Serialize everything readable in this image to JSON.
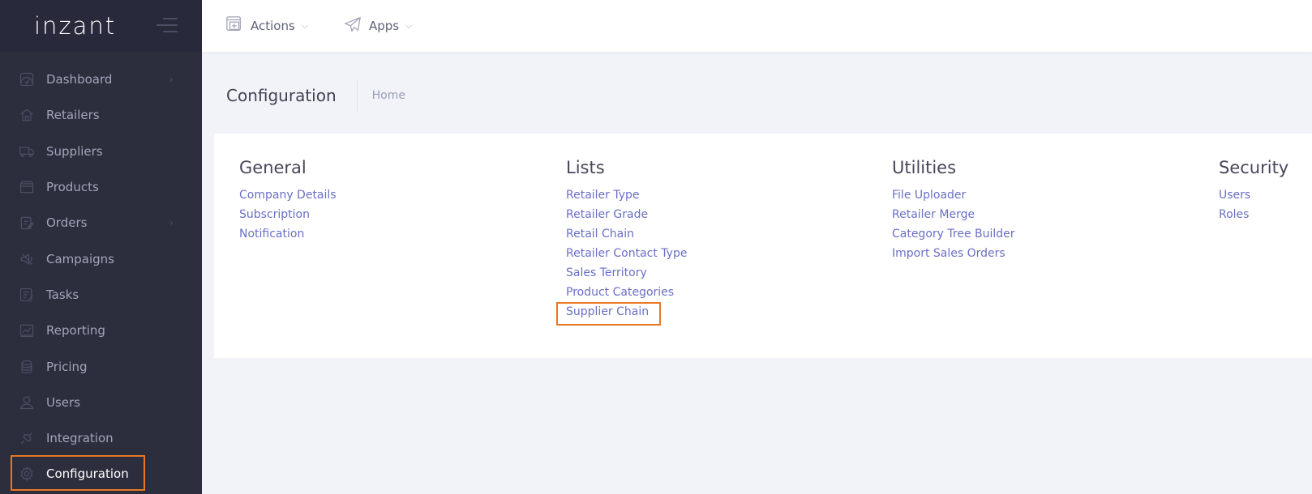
{
  "app": {
    "logo": "inzant"
  },
  "sidebar": {
    "items": [
      {
        "label": "Dashboard",
        "icon": "dashboard-icon",
        "arrow": "›"
      },
      {
        "label": "Retailers",
        "icon": "home-icon"
      },
      {
        "label": "Suppliers",
        "icon": "truck-icon"
      },
      {
        "label": "Products",
        "icon": "box-icon"
      },
      {
        "label": "Orders",
        "icon": "clipboard-icon",
        "arrow": "›"
      },
      {
        "label": "Campaigns",
        "icon": "megaphone-icon"
      },
      {
        "label": "Tasks",
        "icon": "checklist-icon"
      },
      {
        "label": "Reporting",
        "icon": "chart-icon"
      },
      {
        "label": "Pricing",
        "icon": "coins-icon"
      },
      {
        "label": "Users",
        "icon": "users-icon"
      },
      {
        "label": "Integration",
        "icon": "plug-icon"
      },
      {
        "label": "Configuration",
        "icon": "gear-icon"
      }
    ],
    "active": "Configuration"
  },
  "header": {
    "actions_label": "Actions",
    "apps_label": "Apps",
    "caret": "⌵"
  },
  "subheader": {
    "title": "Configuration",
    "breadcrumb": "Home"
  },
  "sections": {
    "general": {
      "title": "General",
      "links": [
        "Company Details",
        "Subscription",
        "Notification"
      ]
    },
    "lists": {
      "title": "Lists",
      "links": [
        "Retailer Type",
        "Retailer Grade",
        "Retail Chain",
        "Retailer Contact Type",
        "Sales Territory",
        "Product Categories",
        "Supplier Chain"
      ]
    },
    "utilities": {
      "title": "Utilities",
      "links": [
        "File Uploader",
        "Retailer Merge",
        "Category Tree Builder",
        "Import Sales Orders"
      ]
    },
    "security": {
      "title": "Security",
      "links": [
        "Users",
        "Roles"
      ]
    }
  },
  "colors": {
    "sidebar_bg": "#2c2e3e",
    "brand_bg": "#282a3c",
    "link": "#6a6fc4",
    "highlight": "#e87722",
    "page_bg": "#f2f3f8"
  }
}
